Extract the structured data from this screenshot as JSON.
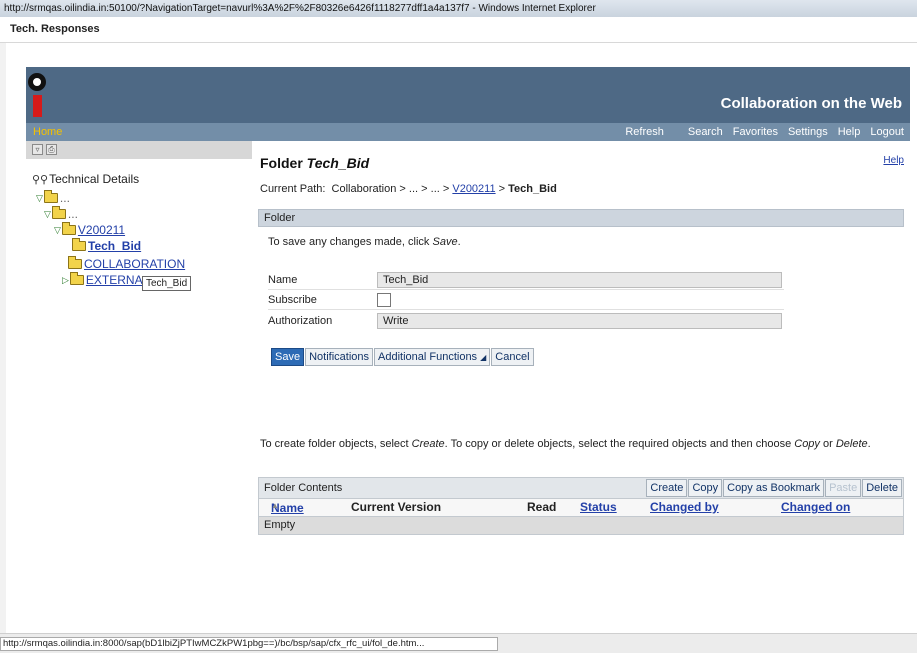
{
  "window": {
    "title": "http://srmqas.oilindia.in:50100/?NavigationTarget=navurl%3A%2F%2F80326e6426f1118277dff1a4a137f7 - Windows Internet Explorer",
    "tab": "Tech. Responses"
  },
  "banner": {
    "brand": "Collaboration on the Web"
  },
  "nav": {
    "home": "Home",
    "refresh": "Refresh",
    "search": "Search",
    "favorites": "Favorites",
    "settings": "Settings",
    "help": "Help",
    "logout": "Logout"
  },
  "sidebar": {
    "tools": [
      "funnel-icon",
      "print-icon"
    ],
    "tree": {
      "root": "Technical Details",
      "ellipsis1": "...",
      "ellipsis2": "...",
      "v200211": "V200211",
      "tech_bid": "Tech_Bid",
      "collaboration": "COLLABORATION",
      "external": "EXTERNA",
      "tooltip": "Tech_Bid"
    }
  },
  "content": {
    "title_prefix": "Folder ",
    "title_name": "Tech_Bid",
    "help": "Help",
    "path": {
      "label": "Current Path:",
      "p1": "Collaboration",
      "p2": "...",
      "p3": "...",
      "p4": "V200211",
      "current": "Tech_Bid"
    },
    "folder_panel": {
      "header": "Folder",
      "hint_prefix": "To save any changes made, click ",
      "hint_action": "Save",
      "hint_suffix": ".",
      "name_label": "Name",
      "name_value": "Tech_Bid",
      "subscribe_label": "Subscribe",
      "auth_label": "Authorization",
      "auth_value": "Write",
      "buttons": {
        "save": "Save",
        "notifications": "Notifications",
        "additional": "Additional Functions",
        "cancel": "Cancel"
      }
    },
    "info": {
      "t1": "To create folder objects, select ",
      "create": "Create",
      "t2": ". To copy or delete objects, select the required objects and then choose ",
      "copy": "Copy",
      "t3": " or ",
      "delete": "Delete",
      "t4": "."
    },
    "contents": {
      "header": "Folder Contents",
      "buttons": {
        "create": "Create",
        "copy": "Copy",
        "copy_bookmark": "Copy as Bookmark",
        "paste": "Paste",
        "delete": "Delete"
      },
      "columns": {
        "name": "Name",
        "version": "Current Version",
        "read": "Read",
        "status": "Status",
        "changed_by": "Changed by",
        "changed_on": "Changed on"
      },
      "empty": "Empty"
    }
  },
  "statusbar": {
    "url": "http://srmqas.oilindia.in:8000/sap(bD1lbiZjPTIwMCZkPW1pbg==)/bc/bsp/sap/cfx_rfc_ui/fol_de.htm..."
  }
}
